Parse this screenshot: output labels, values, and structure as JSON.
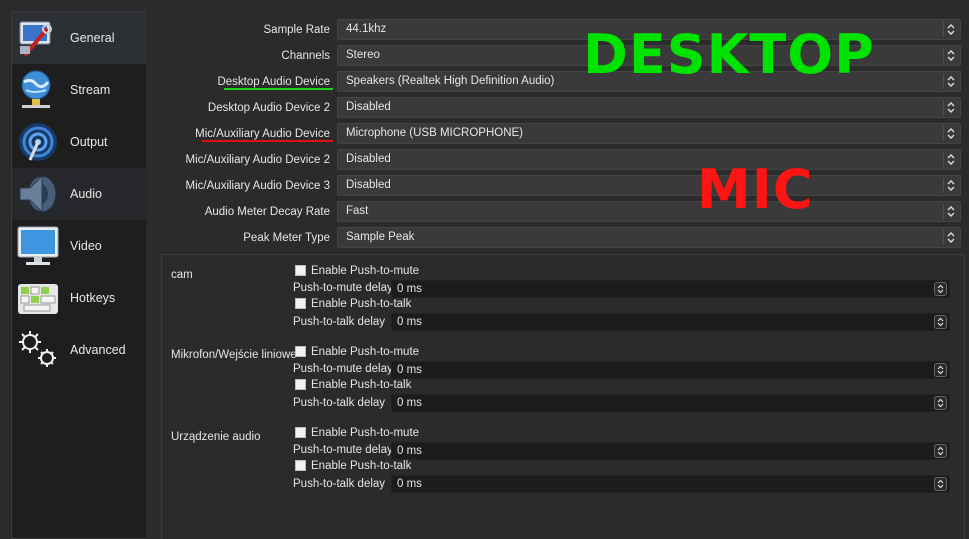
{
  "sidebar": {
    "items": [
      {
        "label": "General",
        "icon": "general-settings-icon"
      },
      {
        "label": "Stream",
        "icon": "globe-network-icon"
      },
      {
        "label": "Output",
        "icon": "broadcast-antenna-icon"
      },
      {
        "label": "Audio",
        "icon": "speaker-icon"
      },
      {
        "label": "Video",
        "icon": "monitor-icon"
      },
      {
        "label": "Hotkeys",
        "icon": "keyboard-icon"
      },
      {
        "label": "Advanced",
        "icon": "gears-icon"
      }
    ]
  },
  "audio": {
    "settings": [
      {
        "label": "Sample Rate",
        "value": "44.1khz"
      },
      {
        "label": "Channels",
        "value": "Stereo"
      },
      {
        "label": "Desktop Audio Device",
        "value": "Speakers (Realtek High Definition Audio)"
      },
      {
        "label": "Desktop Audio Device 2",
        "value": "Disabled"
      },
      {
        "label": "Mic/Auxiliary Audio Device",
        "value": "Microphone (USB MICROPHONE)"
      },
      {
        "label": "Mic/Auxiliary Audio Device 2",
        "value": "Disabled"
      },
      {
        "label": "Mic/Auxiliary Audio Device 3",
        "value": "Disabled"
      },
      {
        "label": "Audio Meter Decay Rate",
        "value": "Fast"
      },
      {
        "label": "Peak Meter Type",
        "value": "Sample Peak"
      }
    ]
  },
  "annotations": {
    "desktop": "DESKTOP",
    "mic": "MIC",
    "desktop_color": "#00e200",
    "mic_color": "#ff1414",
    "desktop_underline_color": "#1fd11f",
    "mic_underline_color": "#e01010"
  },
  "hotkey_sources": [
    {
      "name": "cam",
      "push_to_mute_label": "Enable Push-to-mute",
      "push_to_mute_delay_label": "Push-to-mute delay",
      "push_to_mute_delay": "0 ms",
      "push_to_talk_label": "Enable Push-to-talk",
      "push_to_talk_delay_label": "Push-to-talk delay",
      "push_to_talk_delay": "0 ms"
    },
    {
      "name": "Mikrofon/Wejście liniowe",
      "push_to_mute_label": "Enable Push-to-mute",
      "push_to_mute_delay_label": "Push-to-mute delay",
      "push_to_mute_delay": "0 ms",
      "push_to_talk_label": "Enable Push-to-talk",
      "push_to_talk_delay_label": "Push-to-talk delay",
      "push_to_talk_delay": "0 ms"
    },
    {
      "name": "Urządzenie audio",
      "push_to_mute_label": "Enable Push-to-mute",
      "push_to_mute_delay_label": "Push-to-mute delay",
      "push_to_mute_delay": "0 ms",
      "push_to_talk_label": "Enable Push-to-talk",
      "push_to_talk_delay_label": "Push-to-talk delay",
      "push_to_talk_delay": "0 ms"
    }
  ]
}
